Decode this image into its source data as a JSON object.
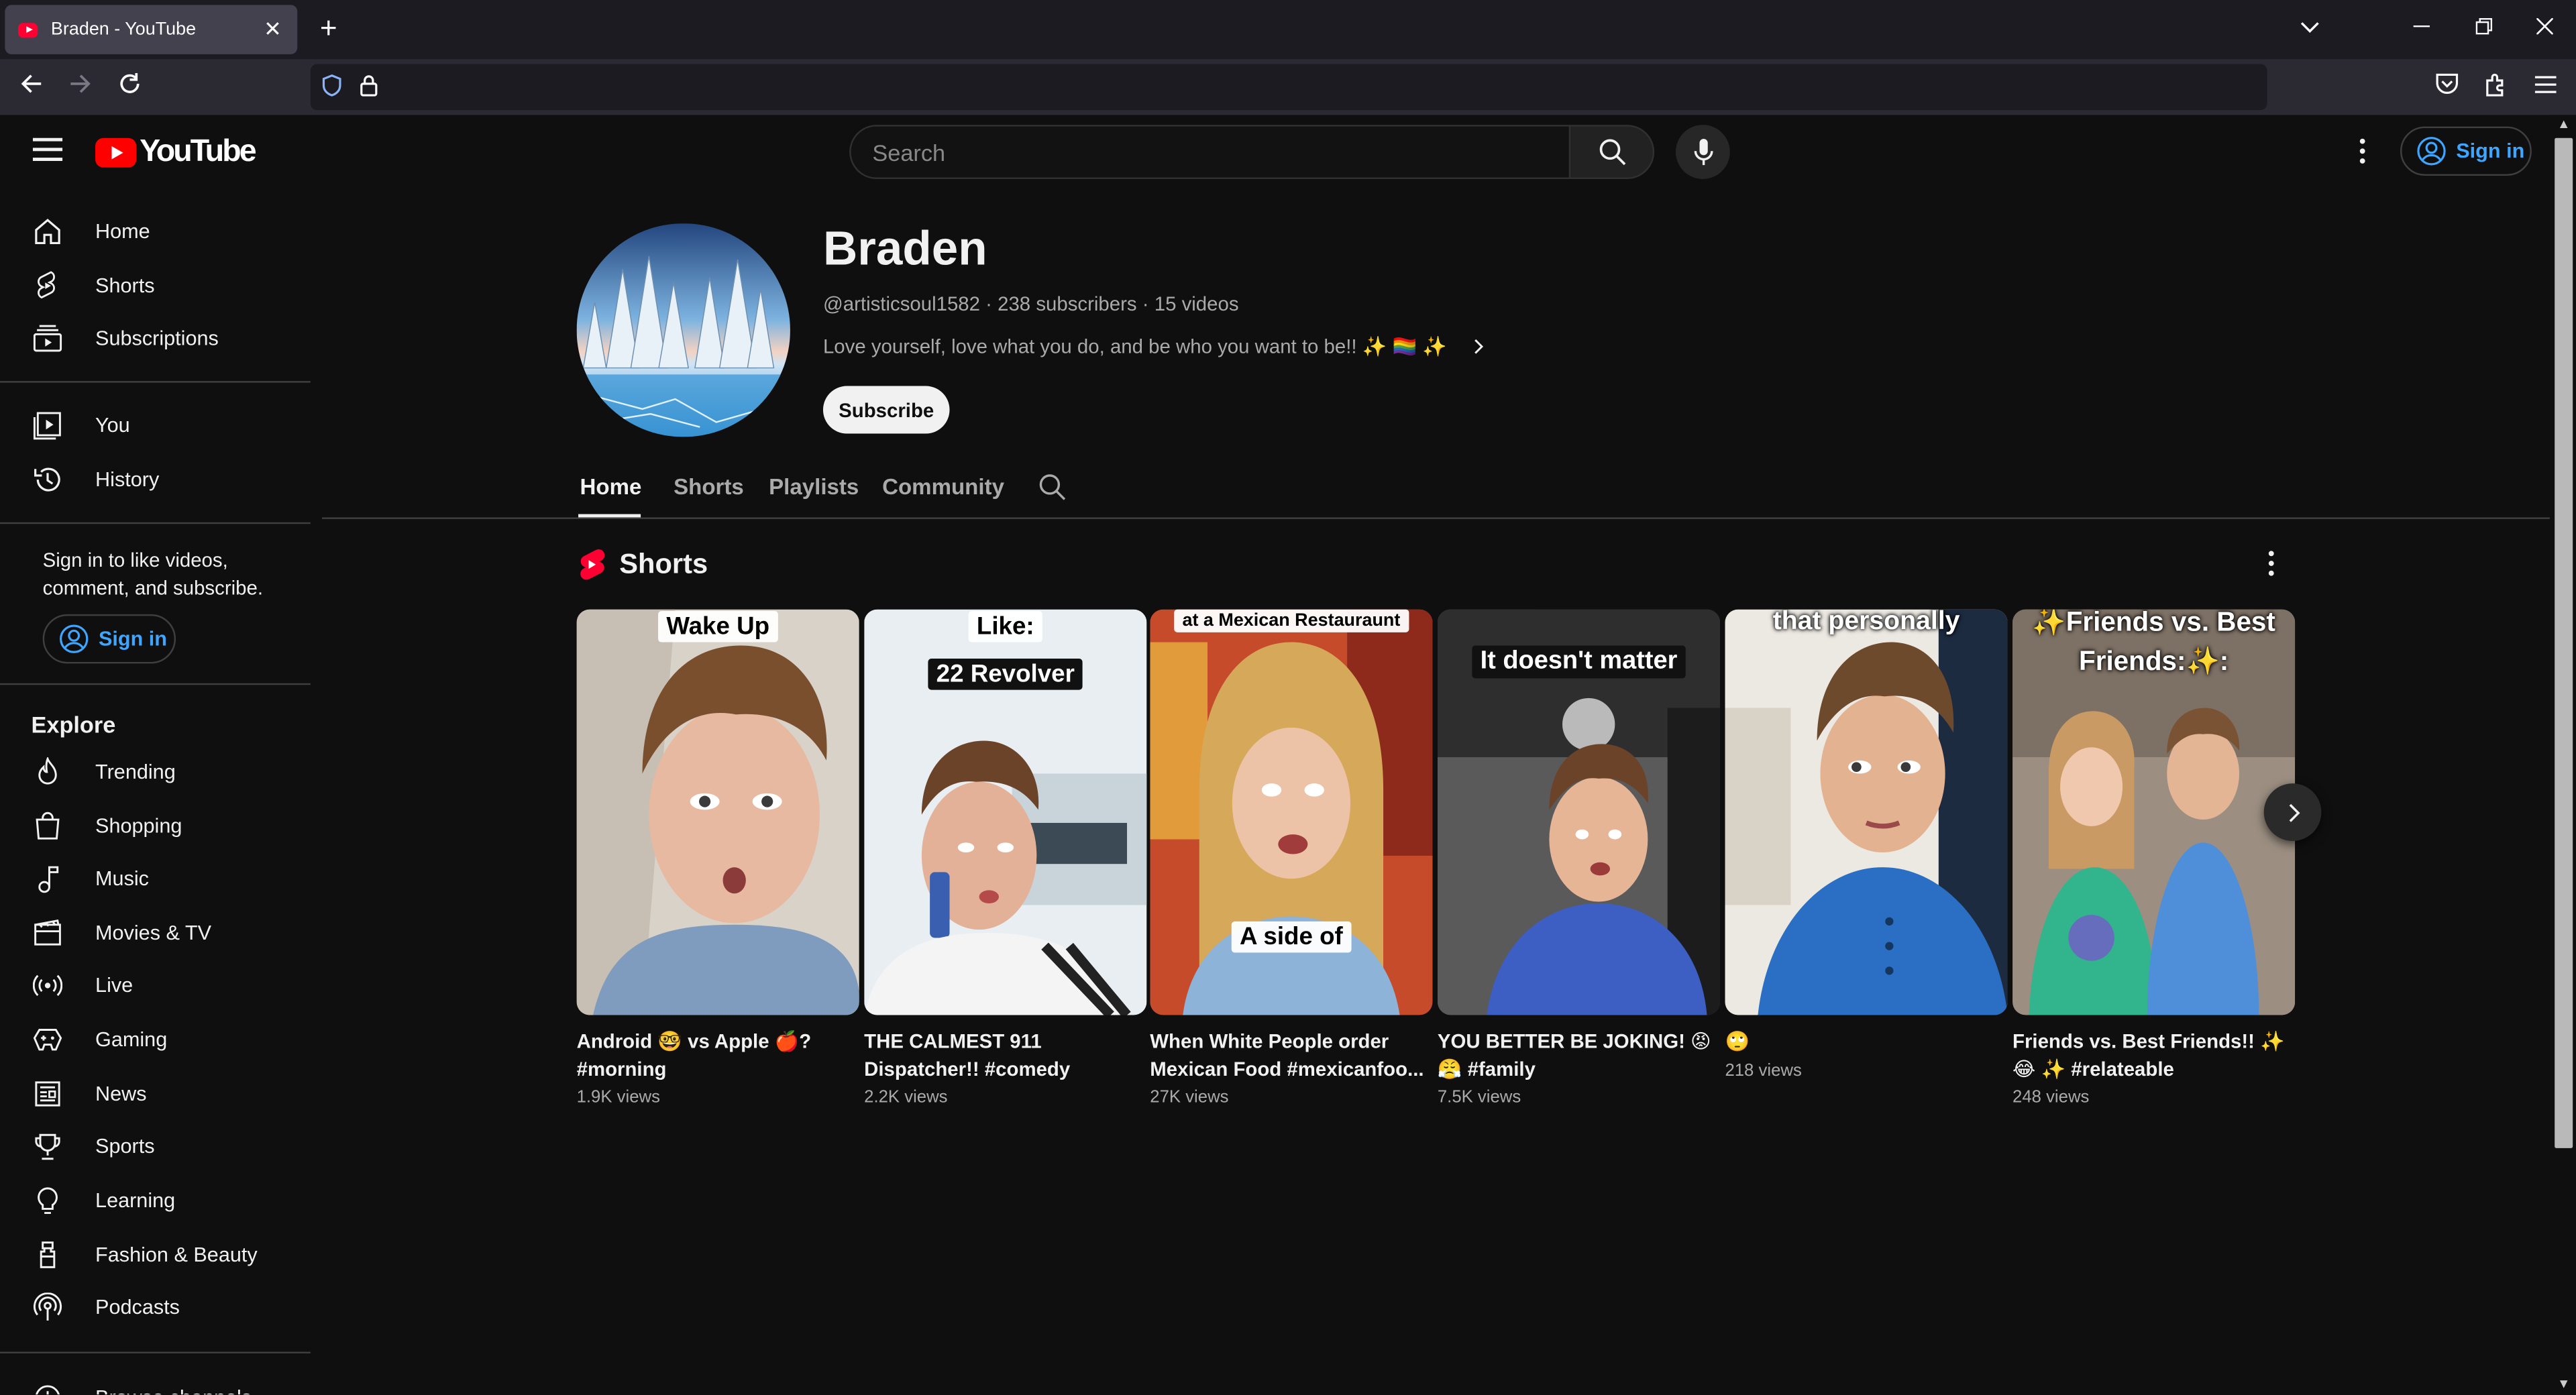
{
  "browser": {
    "tab_title": "Braden - YouTube",
    "tab_close": "✕",
    "new_tab": "+",
    "window_controls": [
      "⌄",
      "—",
      "❐",
      "✕"
    ]
  },
  "masthead": {
    "logo_text": "YouTube",
    "search_placeholder": "Search",
    "signin_label": "Sign in"
  },
  "sidebar": {
    "primary": [
      {
        "label": "Home",
        "icon": "home-icon"
      },
      {
        "label": "Shorts",
        "icon": "shorts-icon"
      },
      {
        "label": "Subscriptions",
        "icon": "subscriptions-icon"
      }
    ],
    "secondary": [
      {
        "label": "You",
        "icon": "you-icon"
      },
      {
        "label": "History",
        "icon": "history-icon"
      }
    ],
    "signin_prompt": "Sign in to like videos, comment, and subscribe.",
    "signin_label": "Sign in",
    "explore_heading": "Explore",
    "explore": [
      {
        "label": "Trending",
        "icon": "trending-icon"
      },
      {
        "label": "Shopping",
        "icon": "shopping-icon"
      },
      {
        "label": "Music",
        "icon": "music-icon"
      },
      {
        "label": "Movies & TV",
        "icon": "movies-icon"
      },
      {
        "label": "Live",
        "icon": "live-icon"
      },
      {
        "label": "Gaming",
        "icon": "gaming-icon"
      },
      {
        "label": "News",
        "icon": "news-icon"
      },
      {
        "label": "Sports",
        "icon": "sports-icon"
      },
      {
        "label": "Learning",
        "icon": "learning-icon"
      },
      {
        "label": "Fashion & Beauty",
        "icon": "fashion-icon"
      },
      {
        "label": "Podcasts",
        "icon": "podcasts-icon"
      }
    ],
    "browse_channels": "Browse channels"
  },
  "channel": {
    "name": "Braden",
    "handle": "@artisticsoul1582",
    "subscribers": "238 subscribers",
    "videos": "15 videos",
    "separator": " · ",
    "description": "Love yourself, love what you do, and be who you want to be!! ✨ 🏳️‍🌈 ✨",
    "subscribe_label": "Subscribe",
    "tabs": [
      "Home",
      "Shorts",
      "Playlists",
      "Community"
    ]
  },
  "shorts_section": {
    "title": "Shorts",
    "items": [
      {
        "title": "Android 🤓 vs Apple 🍎? #morning",
        "views": "1.9K views",
        "captions": [
          "Wake Up"
        ]
      },
      {
        "title": "THE CALMEST 911 Dispatcher!! #comedy",
        "views": "2.2K views",
        "captions": [
          "Like:",
          "22 Revolver"
        ]
      },
      {
        "title": "When White People order Mexican Food #mexicanfoo...",
        "views": "27K views",
        "captions": [
          "at a Mexican Restauraunt",
          "A side of"
        ]
      },
      {
        "title": "YOU BETTER BE JOKING! 😡😤 #family",
        "views": "7.5K views",
        "captions": [
          "It doesn't matter"
        ]
      },
      {
        "title": "🙄",
        "views": "218 views",
        "captions": [
          "that personally"
        ]
      },
      {
        "title": "Friends vs. Best Friends!! ✨😂 ✨ #relateable",
        "views": "248 views",
        "captions": [
          "✨Friends vs. Best",
          "Friends:✨:"
        ]
      }
    ]
  },
  "colors": {
    "background": "#0f0f0f",
    "accent_link": "#3ea6ff",
    "brand_red": "#ff0000"
  }
}
